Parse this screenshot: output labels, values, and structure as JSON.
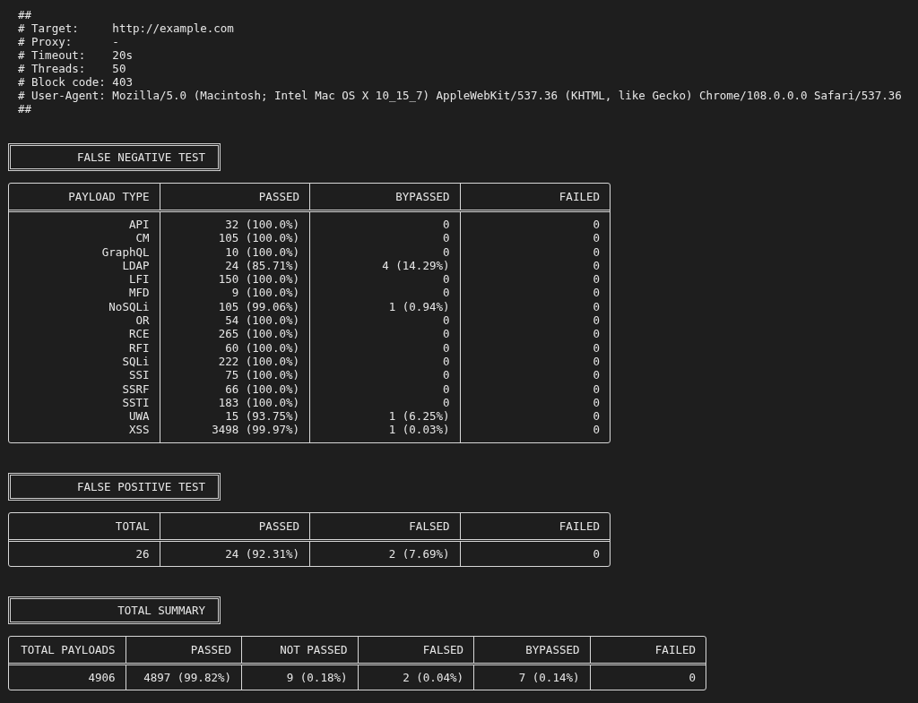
{
  "header_lines": [
    "##",
    "# Target:     http://example.com",
    "# Proxy:      -",
    "# Timeout:    20s",
    "# Threads:    50",
    "# Block code: 403",
    "# User-Agent: Mozilla/5.0 (Macintosh; Intel Mac OS X 10_15_7) AppleWebKit/537.36 (KHTML, like Gecko) Chrome/108.0.0.0 Safari/537.36",
    "##"
  ],
  "sections": [
    {
      "title": "FALSE NEGATIVE TEST",
      "columns": [
        "PAYLOAD TYPE",
        "PASSED",
        "BYPASSED",
        "FAILED"
      ],
      "rows": [
        [
          "API",
          "32 (100.0%)",
          "0",
          "0"
        ],
        [
          "CM",
          "105 (100.0%)",
          "0",
          "0"
        ],
        [
          "GraphQL",
          "10 (100.0%)",
          "0",
          "0"
        ],
        [
          "LDAP",
          "24 (85.71%)",
          "4 (14.29%)",
          "0"
        ],
        [
          "LFI",
          "150 (100.0%)",
          "0",
          "0"
        ],
        [
          "MFD",
          "9 (100.0%)",
          "0",
          "0"
        ],
        [
          "NoSQLi",
          "105 (99.06%)",
          "1 (0.94%)",
          "0"
        ],
        [
          "OR",
          "54 (100.0%)",
          "0",
          "0"
        ],
        [
          "RCE",
          "265 (100.0%)",
          "0",
          "0"
        ],
        [
          "RFI",
          "60 (100.0%)",
          "0",
          "0"
        ],
        [
          "SQLi",
          "222 (100.0%)",
          "0",
          "0"
        ],
        [
          "SSI",
          "75 (100.0%)",
          "0",
          "0"
        ],
        [
          "SSRF",
          "66 (100.0%)",
          "0",
          "0"
        ],
        [
          "SSTI",
          "183 (100.0%)",
          "0",
          "0"
        ],
        [
          "UWA",
          "15 (93.75%)",
          "1 (6.25%)",
          "0"
        ],
        [
          "XSS",
          "3498 (99.97%)",
          "1 (0.03%)",
          "0"
        ]
      ]
    },
    {
      "title": "FALSE POSITIVE TEST",
      "columns": [
        "TOTAL",
        "PASSED",
        "FALSED",
        "FAILED"
      ],
      "rows": [
        [
          "26",
          "24 (92.31%)",
          "2 (7.69%)",
          "0"
        ]
      ]
    },
    {
      "title": "TOTAL SUMMARY",
      "columns": [
        "TOTAL PAYLOADS",
        "PASSED",
        "NOT PASSED",
        "FALSED",
        "BYPASSED",
        "FAILED"
      ],
      "rows": [
        [
          "4906",
          "4897 (99.82%)",
          "9 (0.18%)",
          "2 (0.04%)",
          "7 (0.14%)",
          "0"
        ]
      ]
    }
  ]
}
